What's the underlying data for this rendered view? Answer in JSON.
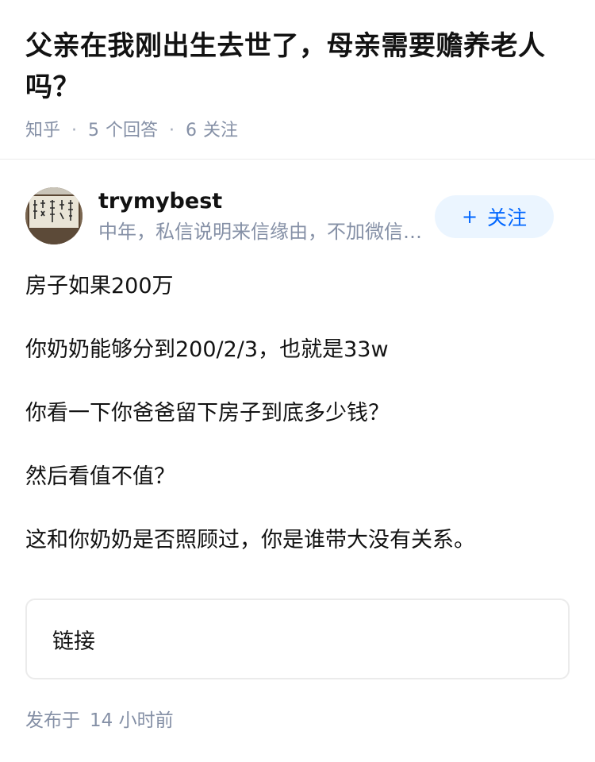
{
  "question": {
    "title": "父亲在我刚出生去世了，母亲需要赡养老人吗？",
    "source": "知乎",
    "answers_count": "5",
    "answers_label": "个回答",
    "follow_count": "6",
    "follow_label": "关注"
  },
  "author": {
    "avatar_icon": "avatar-calligraphy-image",
    "name": "trymybest",
    "bio": "中年，私信说明来信缘由，不加微信、不回…",
    "follow_plus": "+",
    "follow_label": "关注"
  },
  "answer": {
    "paragraphs": [
      "房子如果200万",
      "你奶奶能够分到200/2/3，也就是33w",
      "你看一下你爸爸留下房子到底多少钱？",
      "然后看值不值？",
      "这和你奶奶是否照顾过，你是谁带大没有关系。"
    ],
    "link_label": "链接"
  },
  "footer": {
    "published_prefix": "发布于",
    "published_num": "14",
    "published_unit": "小时前"
  },
  "colors": {
    "text_primary": "#121212",
    "text_secondary": "#8590a6",
    "accent": "#0066ff",
    "accent_bg": "#ebf5ff",
    "divider": "#ebebeb"
  }
}
